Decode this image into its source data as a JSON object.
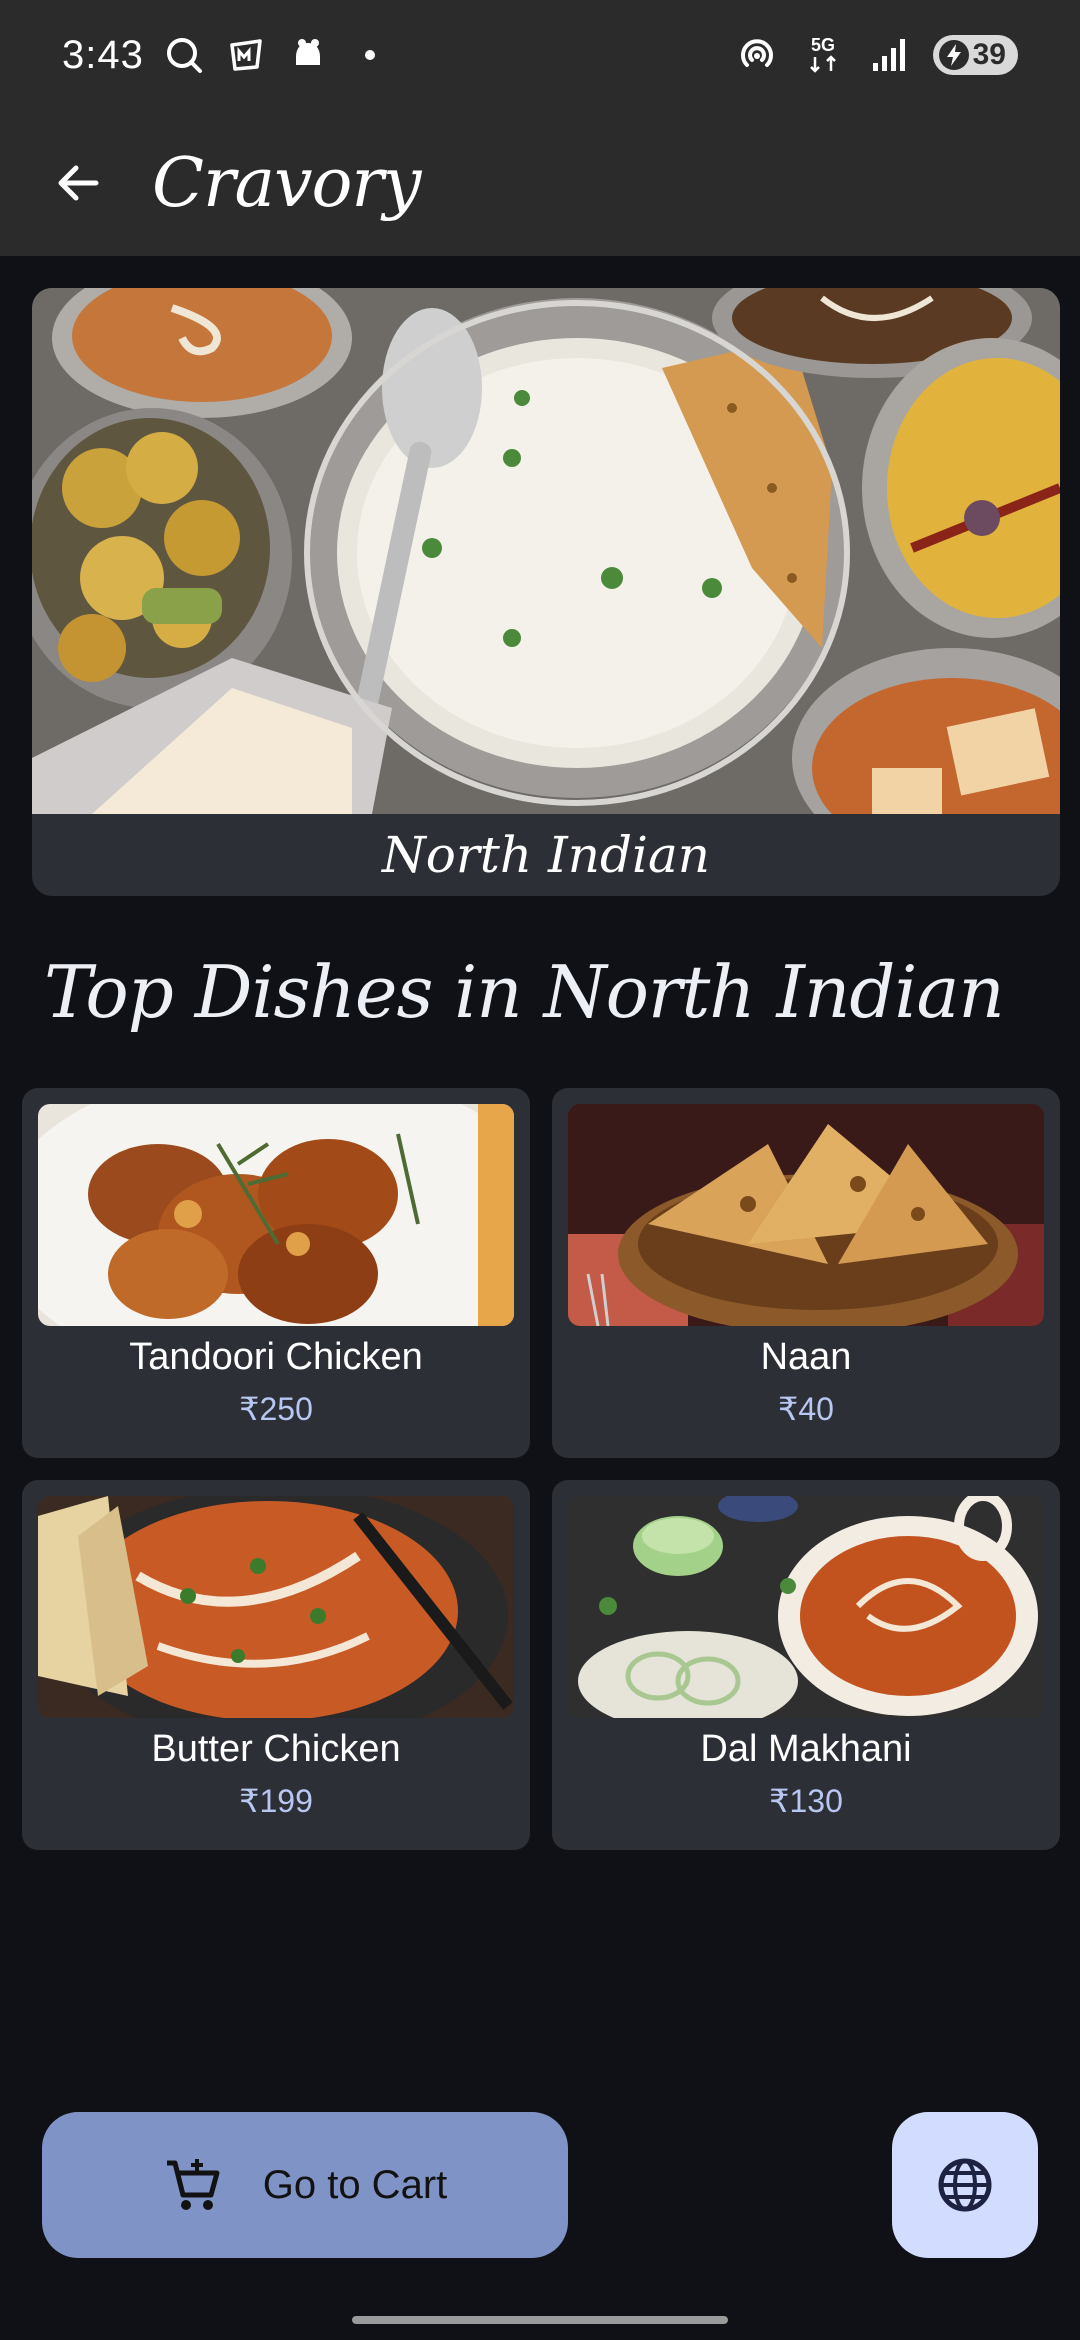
{
  "status_bar": {
    "time": "3:43",
    "battery": "39",
    "network": "5G"
  },
  "app_bar": {
    "title": "Cravory"
  },
  "hero": {
    "category": "North Indian"
  },
  "section": {
    "title": "Top Dishes in North Indian"
  },
  "dishes": [
    {
      "name": "Tandoori Chicken",
      "price": "₹250"
    },
    {
      "name": "Naan",
      "price": "₹40"
    },
    {
      "name": "Butter Chicken",
      "price": "₹199"
    },
    {
      "name": "Dal Makhani",
      "price": "₹130"
    }
  ],
  "actions": {
    "cart_label": "Go to Cart"
  },
  "colors": {
    "background": "#0f1116",
    "bar": "#2b2b2b",
    "card": "#2d2f36",
    "price": "#b8c6f2",
    "cart_button": "#7f93c6",
    "globe_button": "#d2dcff"
  }
}
